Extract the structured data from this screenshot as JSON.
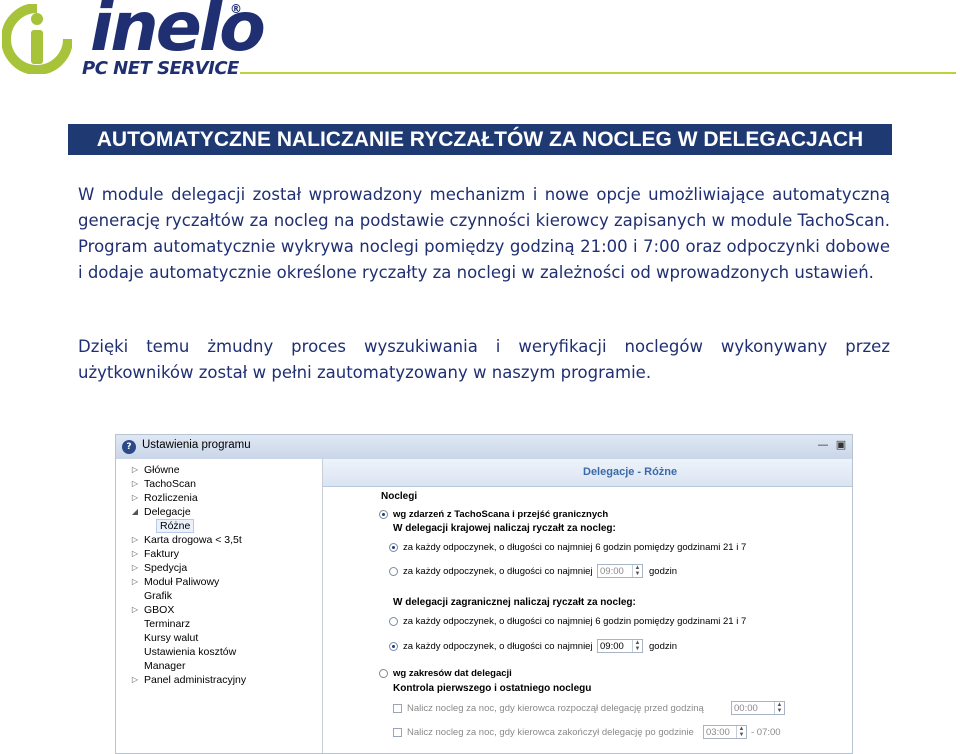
{
  "logo": {
    "word": "inelo",
    "registered": "®",
    "subtitle": "PC NET SERVICE",
    "colors": {
      "navy": "#1f2f72",
      "green": "#a7c33a"
    }
  },
  "banner": {
    "title": "AUTOMATYCZNE NALICZANIE RYCZAŁTÓW ZA NOCLEG W DELEGACJACH",
    "background": "#1f3a72"
  },
  "paragraphs": [
    "W module delegacji został wprowadzony mechanizm i nowe opcje umożliwiające automatyczną generację ryczałtów za nocleg na podstawie czynności kierowcy zapisanych w module TachoScan. Program automatycznie wykrywa noclegi pomiędzy godziną 21:00 i 7:00 oraz odpoczynki dobowe i dodaje automatycznie określone ryczałty za noclegi w zależności od wprowadzonych ustawień.",
    "Dzięki temu żmudny proces wyszukiwania i weryfikacji noclegów wykonywany przez użytkowników został w pełni zautomatyzowany w naszym programie."
  ],
  "window": {
    "title": "Ustawienia programu",
    "tree": [
      {
        "label": "Główne",
        "arrow": "▷",
        "level": 0
      },
      {
        "label": "TachoScan",
        "arrow": "▷",
        "level": 0
      },
      {
        "label": "Rozliczenia",
        "arrow": "▷",
        "level": 0
      },
      {
        "label": "Delegacje",
        "arrow": "◢",
        "level": 0
      },
      {
        "label": "Różne",
        "arrow": "",
        "level": 1,
        "selected": true
      },
      {
        "label": "Karta drogowa < 3,5t",
        "arrow": "▷",
        "level": 0
      },
      {
        "label": "Faktury",
        "arrow": "▷",
        "level": 0
      },
      {
        "label": "Spedycja",
        "arrow": "▷",
        "level": 0
      },
      {
        "label": "Moduł Paliwowy",
        "arrow": "▷",
        "level": 0
      },
      {
        "label": "Grafik",
        "arrow": "",
        "level": 0
      },
      {
        "label": "GBOX",
        "arrow": "▷",
        "level": 0
      },
      {
        "label": "Terminarz",
        "arrow": "",
        "level": 0
      },
      {
        "label": "Kursy walut",
        "arrow": "",
        "level": 0
      },
      {
        "label": "Ustawienia kosztów",
        "arrow": "",
        "level": 0
      },
      {
        "label": "Manager",
        "arrow": "",
        "level": 0
      },
      {
        "label": "Panel administracyjny",
        "arrow": "▷",
        "level": 0
      }
    ],
    "panel": {
      "title": "Delegacje - Różne",
      "group_noclegi": "Noclegi",
      "opt_tacho": "wg zdarzeń z TachoScana i przejść granicznych",
      "domestic_header": "W delegacji krajowej naliczaj ryczałt za nocleg:",
      "domestic_opt1": "za każdy odpoczynek, o długości co najmniej 6 godzin pomiędzy godzinami 21 i 7",
      "domestic_opt2": "za każdy odpoczynek, o długości co najmniej",
      "domestic_value": "09:00",
      "domestic_unit": "godzin",
      "foreign_header": "W delegacji zagranicznej naliczaj ryczałt za nocleg:",
      "foreign_opt1": "za każdy odpoczynek, o długości co najmniej 6 godzin pomiędzy godzinami 21 i 7",
      "foreign_opt2": "za każdy odpoczynek, o długości co najmniej",
      "foreign_value": "09:00",
      "foreign_unit": "godzin",
      "opt_dates": "wg zakresów dat delegacji",
      "control_header": "Kontrola pierwszego i ostatniego noclegu",
      "control_opt1": "Nalicz nocleg za noc, gdy kierowca rozpoczął delegację przed godziną",
      "control_value1": "00:00",
      "control_opt2": "Nalicz nocleg za noc, gdy kierowca zakończył delegację po godzinie",
      "control_value2": "03:00",
      "control_range": "- 07:00"
    }
  }
}
